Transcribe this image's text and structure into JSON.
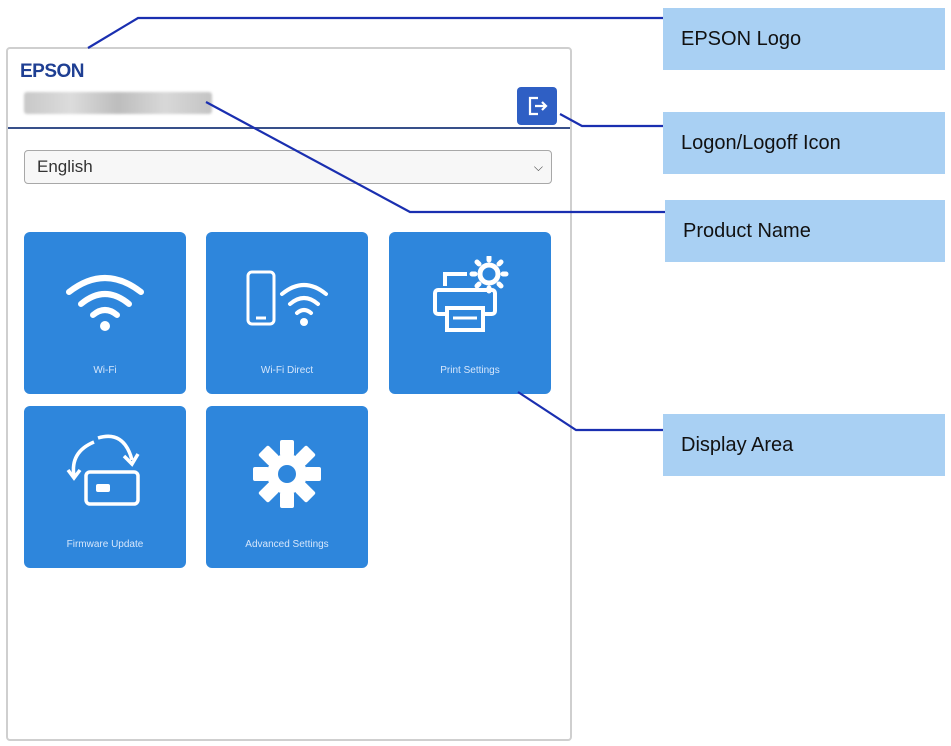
{
  "screen": {
    "logo_text": "EPSON",
    "language_select": {
      "selected": "English"
    },
    "tiles": [
      {
        "label": "Wi-Fi",
        "icon": "wifi-icon"
      },
      {
        "label": "Wi-Fi Direct",
        "icon": "wifi-direct-icon"
      },
      {
        "label": "Print Settings",
        "icon": "printer-settings-icon"
      },
      {
        "label": "Firmware Update",
        "icon": "firmware-update-icon"
      },
      {
        "label": "Advanced Settings",
        "icon": "gear-icon"
      }
    ],
    "logoff_icon": "logoff-icon"
  },
  "callouts": {
    "epson_logo": "EPSON Logo",
    "logon_logoff_icon": "Logon/Logoff Icon",
    "product_name": "Product Name",
    "display_area": "Display Area"
  },
  "colors": {
    "tile_blue": "#2e86dc",
    "logo_navy": "#1f3f93",
    "logoff_blue": "#2f5fc4",
    "callout_bg": "#a9d0f3",
    "leader_line": "#1a2fb0"
  }
}
